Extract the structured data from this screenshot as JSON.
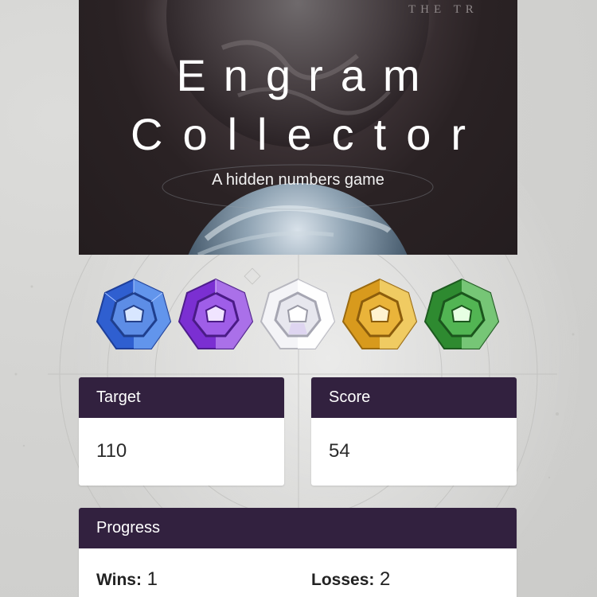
{
  "hero": {
    "title_line1": "Engram",
    "title_line2": "Collector",
    "subtitle": "A hidden numbers game",
    "corner_text": "THE TR"
  },
  "engrams": [
    {
      "name": "blue",
      "color": "#3f77e8"
    },
    {
      "name": "purple",
      "color": "#9b3fe0"
    },
    {
      "name": "white",
      "color": "#e9e9ef"
    },
    {
      "name": "gold",
      "color": "#e9b22c"
    },
    {
      "name": "green",
      "color": "#3ea23f"
    }
  ],
  "target": {
    "label": "Target",
    "value": "110"
  },
  "score": {
    "label": "Score",
    "value": "54"
  },
  "progress": {
    "label": "Progress",
    "wins_label": "Wins:",
    "wins_value": "1",
    "losses_label": "Losses:",
    "losses_value": "2"
  },
  "colors": {
    "header_purple": "#32213f",
    "background": "#d6d6d4"
  }
}
